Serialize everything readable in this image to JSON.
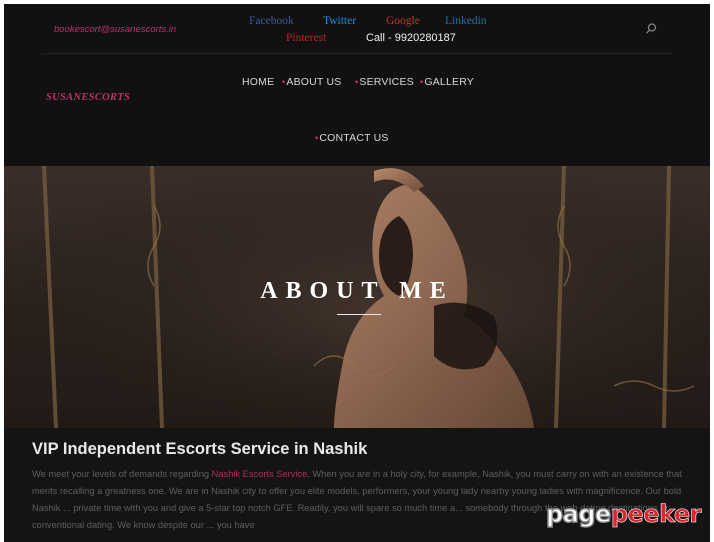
{
  "topbar": {
    "email": "bookescort@susanescorts.in",
    "social": {
      "facebook": "Facebook",
      "twitter": "Twitter",
      "google": "Google",
      "linkedin": "Linkedin",
      "pinterest": "Pinterest"
    },
    "phone": "Call - 9920280187",
    "search_icon": "search-icon"
  },
  "logo": "SUSANESCORTS",
  "nav": {
    "home": "HOME",
    "about": "ABOUT US",
    "services": "SERVICES",
    "gallery": "GALLERY",
    "contact": "CONTACT US",
    "bullet": "•"
  },
  "hero": {
    "title": "ABOUT ME"
  },
  "content": {
    "title": "VIP Independent Escorts Service in Nashik",
    "body_before_link": "We meet your levels of demands regarding ",
    "link_text": "Nashik Escorts Service",
    "body_after_link": ". When you are in a holy city, for example, Nashik, you must carry on with an existence that merits recalling a greatness one. We are in Nashik city to offer you elite models, performers, your young lady nearby young ladies with magnificence. Our bold Nashik ... private time with you and give a 5-star top notch GFE. Readily, you will spare so much time a... somebody through the web dating destinations or conventional dating. We know despite our ... you have"
  },
  "watermark": {
    "part1": "page",
    "part2": "peeker"
  },
  "colors": {
    "accent": "#c0306b",
    "header_bg": "#111111",
    "content_bg": "#141414"
  }
}
